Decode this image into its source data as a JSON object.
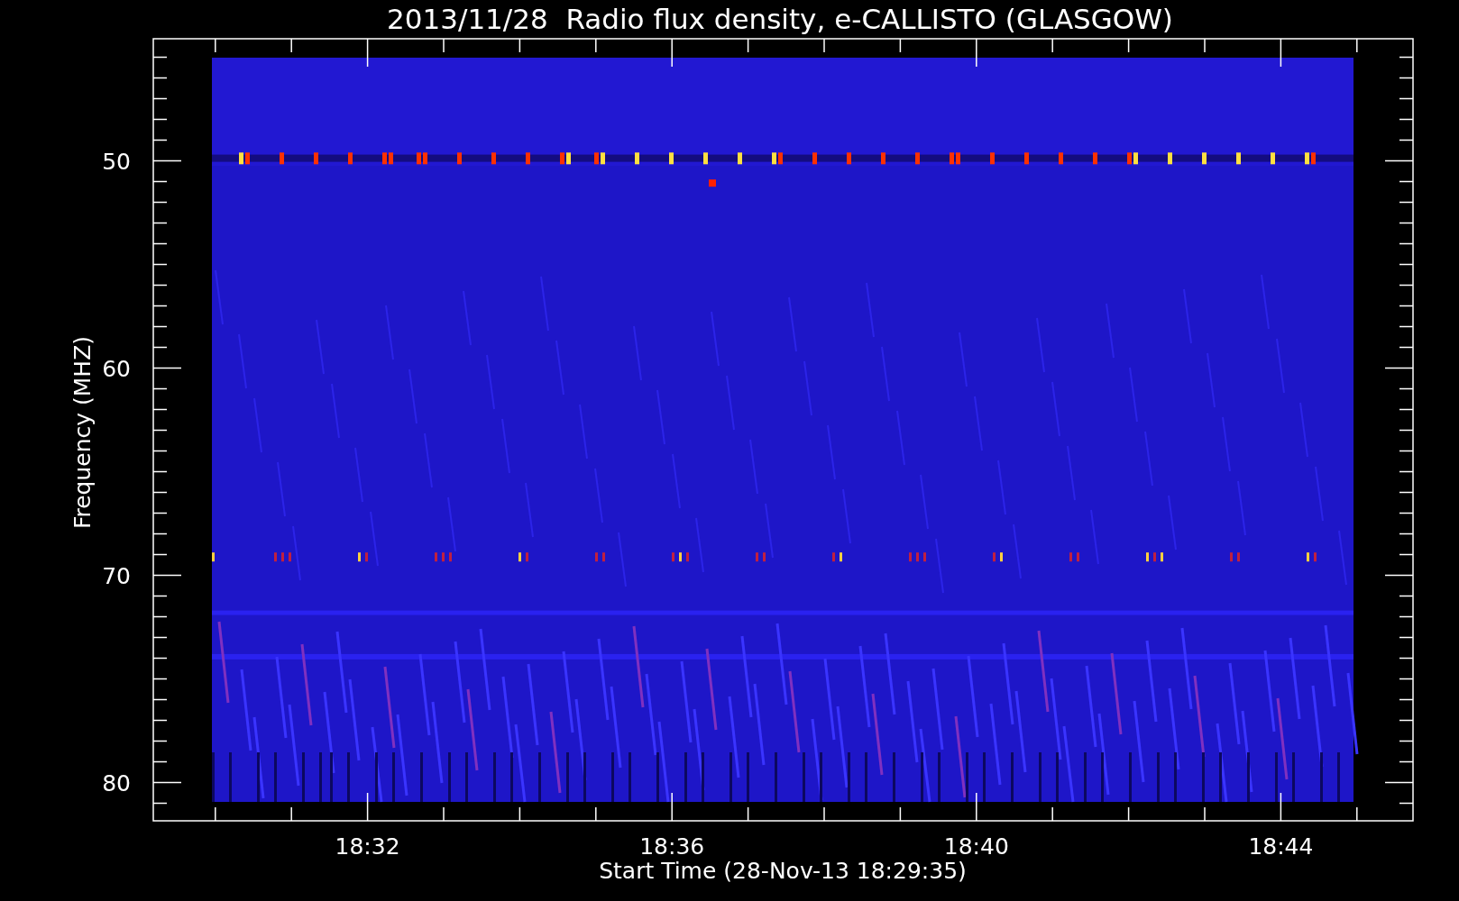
{
  "plot": {
    "title": "2013/11/28  Radio flux density, e-CALLISTO (GLASGOW)",
    "ylabel": "Frequency (MHZ)",
    "xlabel": "Start Time (28-Nov-13 18:29:35)",
    "y_tick_labels": [
      "50",
      "60",
      "70",
      "80"
    ],
    "x_tick_labels": [
      "18:32",
      "18:36",
      "18:40",
      "18:44"
    ]
  }
}
